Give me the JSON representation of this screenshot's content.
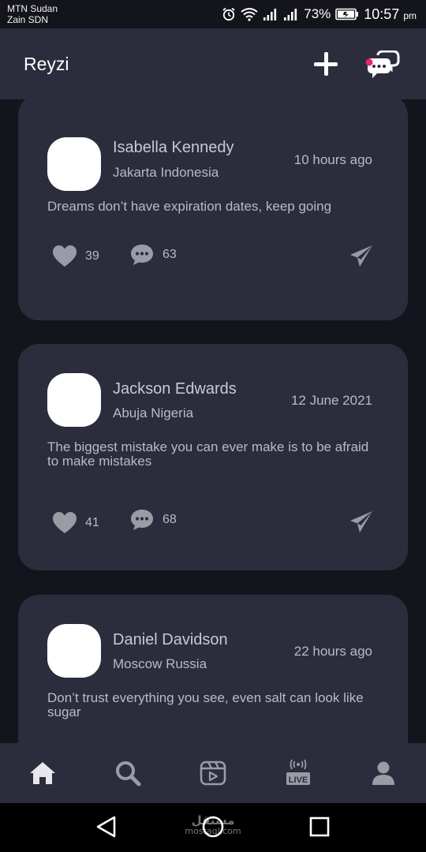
{
  "status_bar": {
    "carrier_1": "MTN Sudan",
    "carrier_2": "Zain SDN",
    "battery": "73%",
    "time": "10:57",
    "ampm": "pm",
    "icons": [
      "alarm-icon",
      "wifi-icon",
      "signal-icon",
      "signal-icon",
      "battery-charging-icon"
    ]
  },
  "app_bar": {
    "title": "Reyzi",
    "actions": [
      "add-icon",
      "chat-icon"
    ]
  },
  "posts": [
    {
      "name": "Isabella Kennedy",
      "location": "Jakarta Indonesia",
      "time": "10 hours ago",
      "text": "Dreams don’t have expiration dates, keep going",
      "likes": "39",
      "comments": "63"
    },
    {
      "name": "Jackson Edwards",
      "location": "Abuja Nigeria",
      "time": "12 June 2021",
      "text": "The biggest mistake you can ever make is to be afraid to make mistakes",
      "likes": "41",
      "comments": "68"
    },
    {
      "name": "Daniel Davidson",
      "location": "Moscow Russia",
      "time": "22 hours ago",
      "text": "Don’t trust everything you see, even salt can look like sugar"
    }
  ],
  "bottom_nav": {
    "items": [
      "home-icon",
      "search-icon",
      "reels-icon",
      "live-icon",
      "profile-icon"
    ],
    "live_label": "LIVE",
    "active": "home-icon"
  },
  "watermark": {
    "arabic": "مستقل",
    "latin": "mostaql.com"
  },
  "colors": {
    "background": "#14151c",
    "card": "#2b2d3c",
    "text_primary": "#c8c9d2",
    "text_secondary": "#b9bac4",
    "icon_muted": "#9a9ba5",
    "accent_dot": "#e8246a"
  }
}
